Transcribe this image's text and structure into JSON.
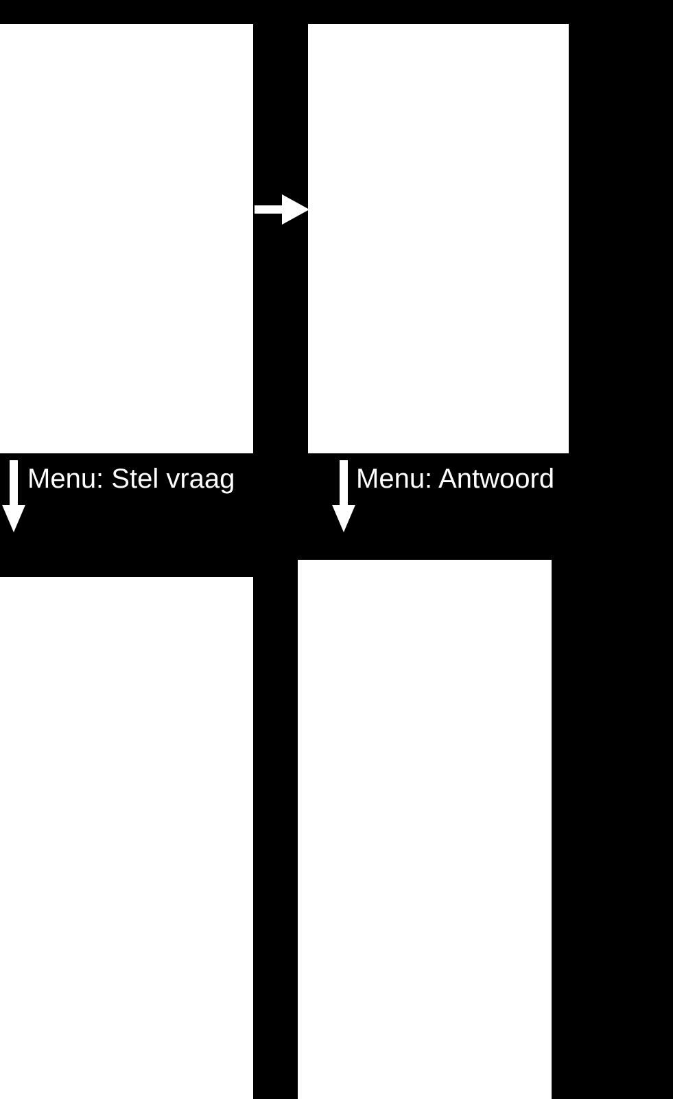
{
  "labels": {
    "left": "Menu: Stel vraag",
    "right": "Menu: Antwoord"
  }
}
